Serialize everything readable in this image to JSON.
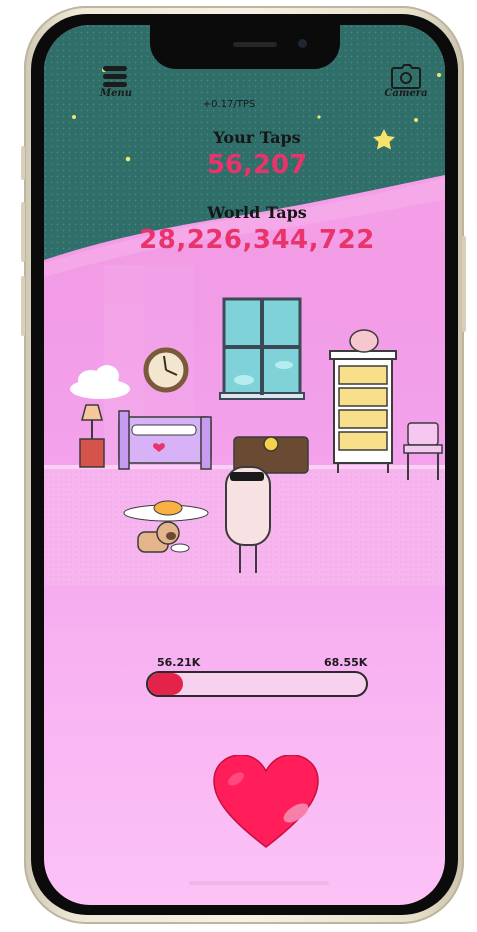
{
  "colors": {
    "accent_pink": "#e8336b",
    "heart_red": "#ff1e5a",
    "sky_teal": "#2f6e69",
    "room_pink": "#f29be6"
  },
  "header": {
    "menu": {
      "icon": "menu-icon",
      "label": "Menu"
    },
    "camera": {
      "icon": "camera-icon",
      "label": "Camera"
    }
  },
  "stats": {
    "tps": "+0.17/TPS",
    "your_taps_label": "Your Taps",
    "your_taps_value": "56,207",
    "world_taps_label": "World Taps",
    "world_taps_value": "28,226,344,722"
  },
  "progress": {
    "min_label": "56.21K",
    "max_label": "68.55K",
    "fraction": 0.16
  },
  "tap_button": {
    "icon": "heart-icon"
  }
}
